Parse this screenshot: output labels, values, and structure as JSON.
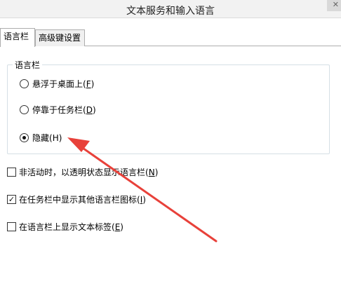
{
  "window": {
    "title": "文本服务和输入语言"
  },
  "tabs": [
    {
      "label": "语言栏",
      "active": true
    },
    {
      "label": "高级键设置",
      "active": false
    }
  ],
  "language_bar_group": {
    "label": "语言栏",
    "options": [
      {
        "text": "悬浮于桌面上",
        "accel": "(F)",
        "accel_letter": "F",
        "checked": false
      },
      {
        "text": "停靠于任务栏",
        "accel": "(D)",
        "accel_letter": "D",
        "checked": false
      },
      {
        "text": "隐藏",
        "accel": "(H)",
        "accel_letter": "H",
        "checked": true
      }
    ]
  },
  "checkboxes": [
    {
      "text": "非活动时，以透明状态显示语言栏",
      "accel_letter": "N",
      "checked": false
    },
    {
      "text": "在任务栏中显示其他语言栏图标",
      "accel_letter": "I",
      "checked": true
    },
    {
      "text": "在语言栏上显示文本标签",
      "accel_letter": "E",
      "checked": false
    }
  ],
  "annotation": {
    "arrow_color": "#e8413a"
  },
  "icons": {
    "close": "close-icon",
    "check": "checkmark-icon"
  }
}
